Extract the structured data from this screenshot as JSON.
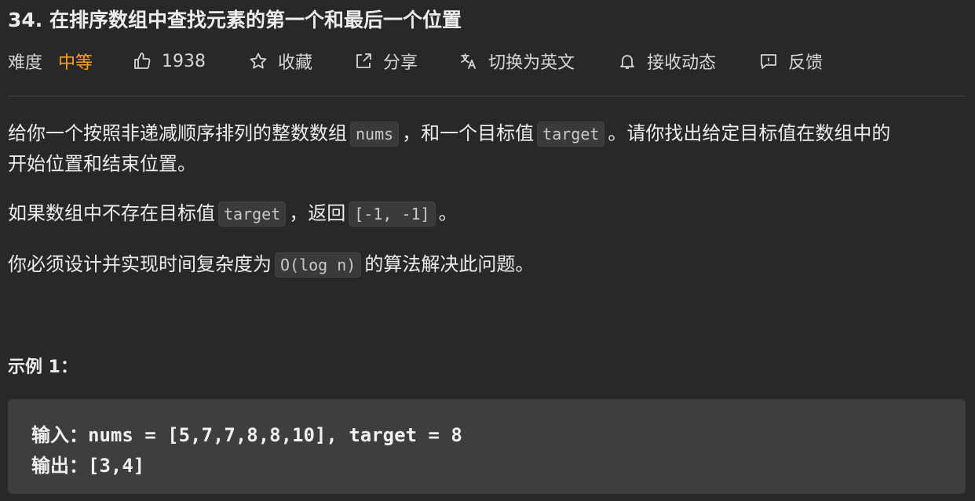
{
  "problem": {
    "title": "34. 在排序数组中查找元素的第一个和最后一个位置"
  },
  "meta": {
    "difficulty_label": "难度",
    "difficulty_value": "中等",
    "difficulty_color": "#ffa116",
    "likes": "1938",
    "favorite": "收藏",
    "share": "分享",
    "translate": "切换为英文",
    "subscribe": "接收动态",
    "feedback": "反馈",
    "icons": [
      "thumbs-up-icon",
      "star-icon",
      "share-icon",
      "translate-icon",
      "bell-icon",
      "feedback-icon"
    ]
  },
  "description": {
    "p1_a": "给你一个按照非递减顺序排列的整数数组",
    "p1_code1": "nums",
    "p1_b": "，和一个目标值",
    "p1_code2": "target",
    "p1_c": "。请你找出给定目标值在数组中的",
    "p1_d": "开始位置和结束位置。",
    "p2_a": "如果数组中不存在目标值",
    "p2_code1": "target",
    "p2_b": "，返回",
    "p2_code2": "[-1, -1]",
    "p2_c": "。",
    "p3_a": "你必须设计并实现时间复杂度为",
    "p3_code": "O(log n)",
    "p3_b": "的算法解决此问题。"
  },
  "example": {
    "title": "示例 1：",
    "input": "输入：nums = [5,7,7,8,8,10], target = 8",
    "output": "输出：[3,4]"
  }
}
